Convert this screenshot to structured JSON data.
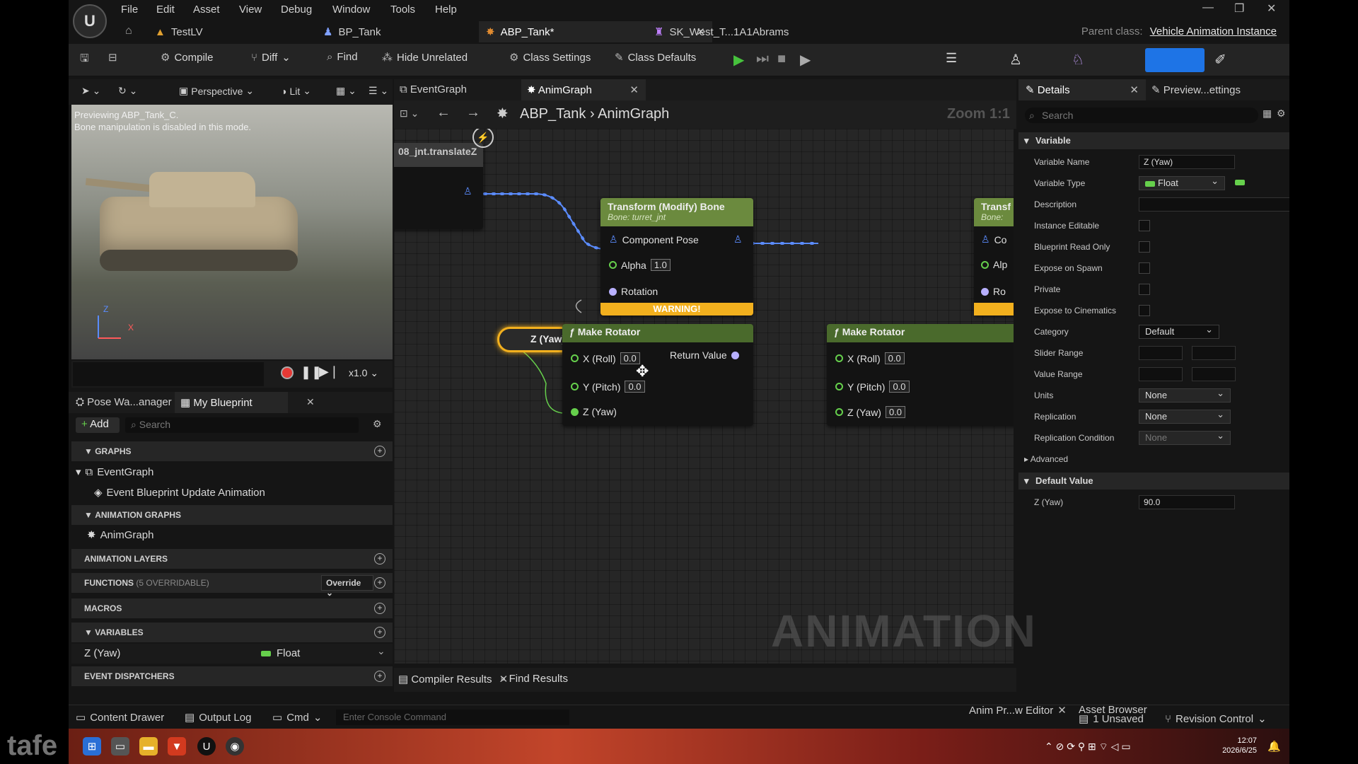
{
  "menu": [
    "File",
    "Edit",
    "Asset",
    "View",
    "Debug",
    "Window",
    "Tools",
    "Help"
  ],
  "doc_tabs": [
    {
      "label": "TestLV"
    },
    {
      "label": "BP_Tank"
    },
    {
      "label": "ABP_Tank*"
    },
    {
      "label": "SK_West_T...1A1Abrams"
    }
  ],
  "parent_class": {
    "label": "Parent class:",
    "value": "Vehicle Animation Instance"
  },
  "toolbar": {
    "compile": "Compile",
    "diff": "Diff",
    "find": "Find",
    "hide_unrelated": "Hide Unrelated",
    "class_settings": "Class Settings",
    "class_defaults": "Class Defaults"
  },
  "viewport": {
    "perspective": "Perspective",
    "lit": "Lit",
    "preview_line1": "Previewing ABP_Tank_C.",
    "preview_line2": "Bone manipulation is disabled in this mode.",
    "axis_z": "Z",
    "axis_x": "X",
    "speed": "x1.0"
  },
  "blueprint_panel": {
    "tab_pose": "Pose Wa...anager",
    "tab_my": "My Blueprint",
    "add": "Add",
    "search_placeholder": "Search",
    "graphs": "GRAPHS",
    "event_graph": "EventGraph",
    "event_update": "Event Blueprint Update Animation",
    "animation_graphs": "ANIMATION GRAPHS",
    "anim_graph": "AnimGraph",
    "animation_layers": "ANIMATION LAYERS",
    "functions": "FUNCTIONS",
    "functions_count": "(5 OVERRIDABLE)",
    "override": "Override",
    "macros": "MACROS",
    "variables": "VARIABLES",
    "var_name": "Z (Yaw)",
    "var_type": "Float",
    "event_dispatchers": "EVENT DISPATCHERS"
  },
  "graph": {
    "tab_event": "EventGraph",
    "tab_anim": "AnimGraph",
    "crumb_root": "ABP_Tank",
    "crumb_leaf": "AnimGraph",
    "zoom": "Zoom 1:1",
    "node_left_title": "08_jnt.translateZ",
    "transform_title": "Transform (Modify) Bone",
    "transform_sub": "Bone: turret_jnt",
    "component_pose": "Component Pose",
    "alpha": "Alpha",
    "alpha_val": "1.0",
    "rotation": "Rotation",
    "warning": "WARNING!",
    "transform2_title": "Transf",
    "transform2_sub": "Bone:",
    "co": "Co",
    "alp": "Alp",
    "ro": "Ro",
    "var_node": "Z (Yaw)",
    "make_rotator": "Make Rotator",
    "x_roll": "X (Roll)",
    "y_pitch": "Y (Pitch)",
    "z_yaw": "Z (Yaw)",
    "zero": "0.0",
    "return_value": "Return Value",
    "watermark": "ANIMATION"
  },
  "bottom_tabs": {
    "compiler": "Compiler Results",
    "find": "Find Results"
  },
  "details": {
    "tab_details": "Details",
    "tab_preview": "Preview...ettings",
    "search_placeholder": "Search",
    "cat_variable": "Variable",
    "variable_name": "Variable Name",
    "variable_name_val": "Z (Yaw)",
    "variable_type": "Variable Type",
    "variable_type_val": "Float",
    "description": "Description",
    "instance_editable": "Instance Editable",
    "blueprint_read_only": "Blueprint Read Only",
    "expose_on_spawn": "Expose on Spawn",
    "private": "Private",
    "expose_to_cinematics": "Expose to Cinematics",
    "category": "Category",
    "category_val": "Default",
    "slider_range": "Slider Range",
    "value_range": "Value Range",
    "units": "Units",
    "units_val": "None",
    "replication": "Replication",
    "replication_val": "None",
    "replication_condition": "Replication Condition",
    "replication_condition_val": "None",
    "advanced": "Advanced",
    "cat_default": "Default Value",
    "default_z": "Z (Yaw)",
    "default_z_val": "90.0"
  },
  "status": {
    "content_drawer": "Content Drawer",
    "output_log": "Output Log",
    "cmd": "Cmd",
    "console_placeholder": "Enter Console Command",
    "anim_editor": "Anim Pr...w Editor",
    "asset_browser": "Asset Browser",
    "unsaved": "1 Unsaved",
    "revision": "Revision Control"
  },
  "taskbar": {
    "time": "12:07",
    "date": "2026/6/25",
    "watermark": "tafe"
  },
  "colors": {
    "accent_blue": "#1e74e6",
    "pose_wire": "#5b8cff",
    "warning": "#f2b01e",
    "float_green": "#66d04c"
  },
  "icons": [
    "unreal-logo-icon",
    "save-icon",
    "compile-icon",
    "find-icon",
    "gear-icon",
    "play-icon",
    "close-icon",
    "search-icon"
  ]
}
